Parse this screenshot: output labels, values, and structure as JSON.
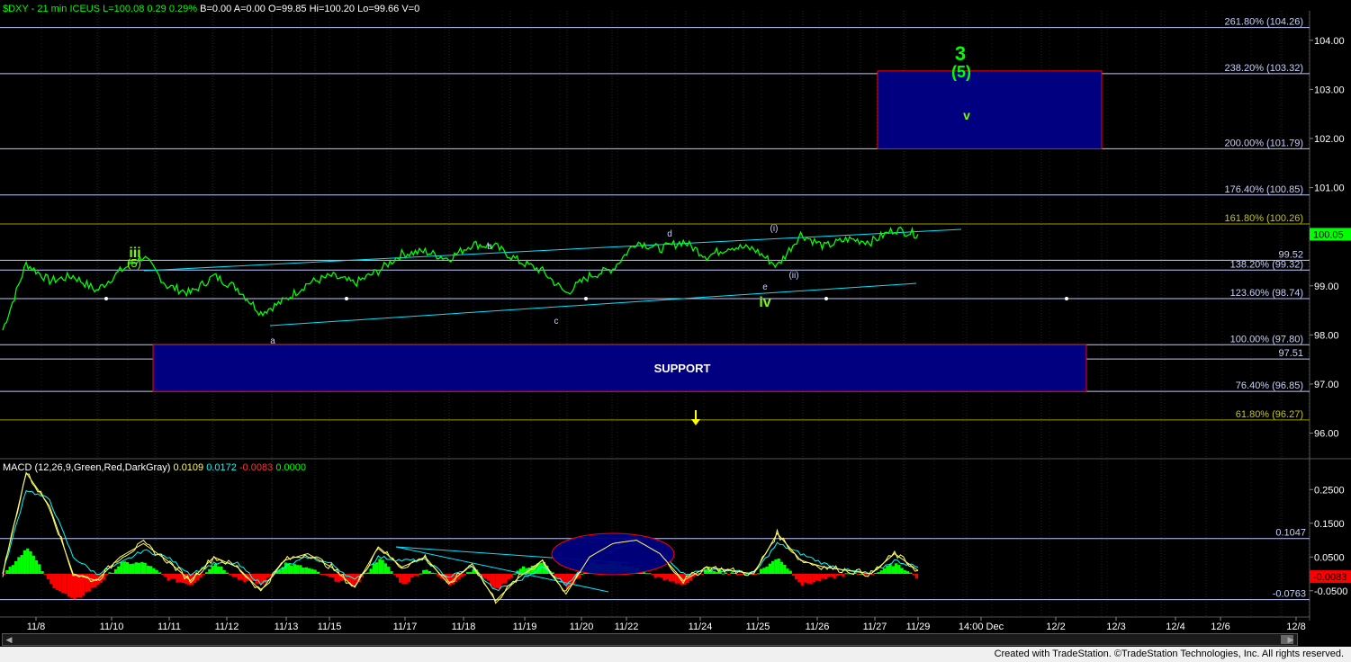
{
  "header": {
    "symbol": "$DXY",
    "interval": "21 min",
    "exchange": "ICEUS",
    "last": "L=100.08",
    "change": "0.29",
    "change_pct": "0.29%",
    "bid": "B=0.00",
    "ask": "A=0.00",
    "open": "O=99.85",
    "high": "Hi=100.20",
    "low": "Lo=99.66",
    "volume": "V=0"
  },
  "macd_header": {
    "name": "MACD (12,26,9,Green,Red,DarkGray)",
    "v1": "0.0109",
    "v2": "0.0172",
    "v3": "-0.0083",
    "v4": "0.0000"
  },
  "footer": "Created with TradeStation. ©TradeStation Technologies, Inc. All rights reserved.",
  "colors": {
    "price_line": "#00ff00",
    "fib_line": "#c0c8ff",
    "fib_gold": "#9b9b00",
    "box_fill": "#000080",
    "box_border": "#ff0000",
    "trend_line": "#00e5ff",
    "wave_green": "#7CFC00",
    "label_light": "#c8d0ff",
    "macd_line": "#ffff66",
    "signal_line": "#00ffff"
  },
  "chart_data": [
    {
      "type": "line",
      "title": "$DXY - 21 min",
      "ylim": [
        95.8,
        104.6
      ],
      "y_ticks": [
        "104.00",
        "103.00",
        "102.00",
        "101.00",
        "100.00",
        "99.00",
        "98.00",
        "97.00",
        "96.00"
      ],
      "x_ticks": [
        "11/8",
        "11/10",
        "11/11",
        "11/12",
        "11/13",
        "11/15",
        "11/17",
        "11/18",
        "11/19",
        "11/20",
        "11/22",
        "11/24",
        "11/25",
        "11/26",
        "11/27",
        "11/29",
        "14:00 Dec",
        "12/2",
        "12/3",
        "12/4",
        "12/6",
        "12/8"
      ],
      "last_price": "100.05",
      "fib_levels": [
        {
          "label": "261.80% (104.26)",
          "value": 104.26,
          "gold": false
        },
        {
          "label": "238.20% (103.32)",
          "value": 103.32,
          "gold": false
        },
        {
          "label": "200.00% (101.79)",
          "value": 101.79,
          "gold": false
        },
        {
          "label": "176.40% (100.85)",
          "value": 100.85,
          "gold": false
        },
        {
          "label": "161.80% (100.26)",
          "value": 100.26,
          "gold": true
        },
        {
          "label": "99.52",
          "value": 99.52,
          "gold": false
        },
        {
          "label": "138.20% (99.32)",
          "value": 99.32,
          "gold": false
        },
        {
          "label": "123.60% (98.74)",
          "value": 98.74,
          "gold": false
        },
        {
          "label": "100.00% (97.80)",
          "value": 97.8,
          "gold": false
        },
        {
          "label": "97.51",
          "value": 97.51,
          "gold": false
        },
        {
          "label": "76.40% (96.85)",
          "value": 96.85,
          "gold": false
        },
        {
          "label": "61.80% (96.27)",
          "value": 96.27,
          "gold": true
        }
      ],
      "boxes": [
        {
          "label": "SUPPORT",
          "top": 97.8,
          "bottom": 96.85,
          "x_start": "11/10",
          "x_end": "12/3"
        },
        {
          "label": "v",
          "top": 103.32,
          "bottom": 101.79,
          "x_start": "11/27",
          "x_end": "12/2"
        }
      ],
      "wave_labels": [
        "iii",
        "(5)",
        "a",
        "b",
        "c",
        "d",
        "e",
        "(i)",
        "(ii)",
        "iv",
        "3",
        "(5)",
        "v"
      ],
      "series": [
        {
          "values": [
            98.1,
            99.45,
            99.1,
            99.2,
            98.9,
            99.3,
            99.6,
            99.0,
            98.85,
            99.2,
            98.95,
            98.45,
            98.7,
            99.05,
            99.2,
            99.05,
            99.3,
            99.65,
            99.7,
            99.55,
            99.85,
            99.8,
            99.5,
            99.3,
            98.85,
            99.2,
            99.35,
            99.9,
            99.75,
            99.9,
            99.6,
            99.8,
            99.75,
            99.4,
            100.05,
            99.8,
            99.95,
            99.9,
            100.15,
            100.05
          ]
        }
      ]
    },
    {
      "type": "line",
      "title": "MACD (12,26,9,Green,Red,DarkGray)",
      "ylim": [
        -0.08,
        0.3
      ],
      "y_ticks": [
        "0.2500",
        "0.1500",
        "0.0500",
        "-0.0500"
      ],
      "level_labels": [
        "0.1047",
        "-0.0763",
        "-0.0083"
      ],
      "series": [
        {
          "name": "MACD",
          "values": [
            0.0,
            0.3,
            0.2,
            0.0,
            -0.02,
            0.05,
            0.09,
            0.04,
            -0.02,
            0.05,
            0.02,
            -0.05,
            0.04,
            0.06,
            0.02,
            -0.04,
            0.08,
            0.02,
            0.05,
            -0.03,
            0.03,
            -0.08,
            -0.01,
            0.04,
            -0.06,
            0.05,
            0.09,
            0.1,
            0.06,
            -0.02,
            0.02,
            0.01,
            0.0,
            0.12,
            0.04,
            0.02,
            0.01,
            0.0,
            0.06,
            0.01
          ]
        },
        {
          "name": "Signal",
          "values": [
            0.0,
            0.25,
            0.22,
            0.05,
            0.0,
            0.03,
            0.07,
            0.05,
            0.0,
            0.03,
            0.03,
            -0.03,
            0.02,
            0.05,
            0.03,
            -0.02,
            0.05,
            0.04,
            0.04,
            -0.01,
            0.02,
            -0.05,
            -0.02,
            0.02,
            -0.03,
            0.03,
            0.07,
            0.09,
            0.07,
            0.0,
            0.01,
            0.01,
            0.0,
            0.09,
            0.06,
            0.03,
            0.01,
            0.0,
            0.04,
            0.02
          ]
        }
      ]
    }
  ]
}
